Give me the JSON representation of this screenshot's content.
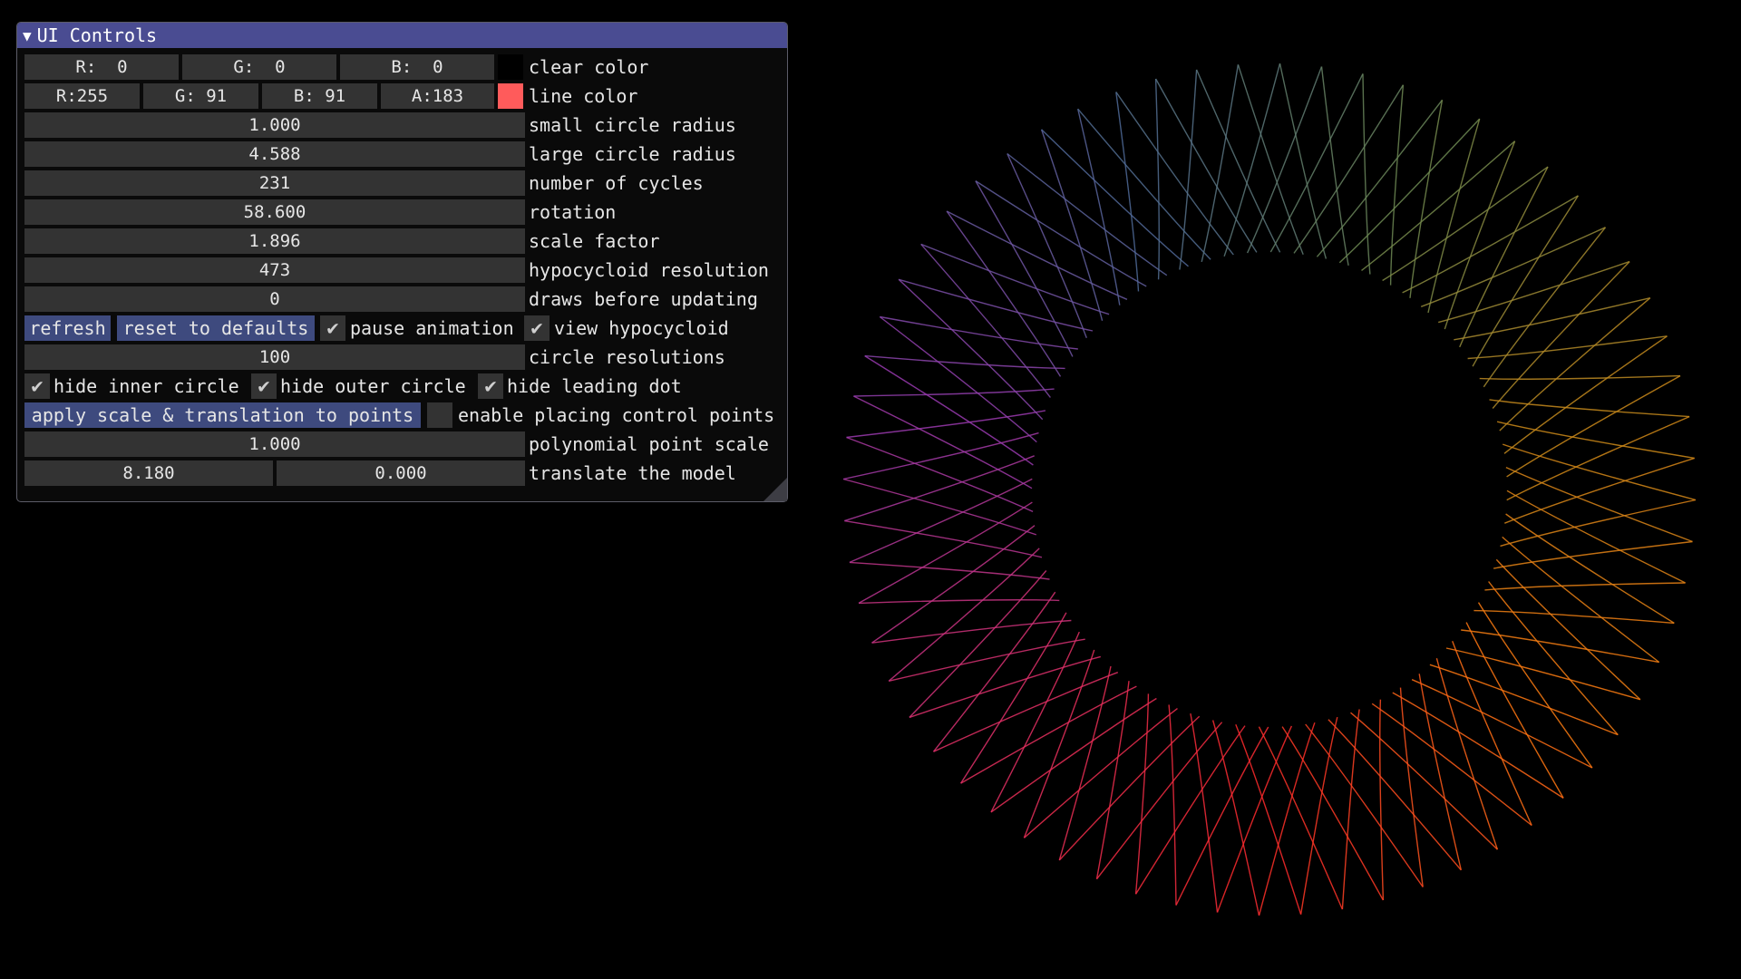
{
  "window": {
    "title": "UI Controls",
    "collapse_icon": "triangle-down-icon"
  },
  "clear_color": {
    "r": "R:  0",
    "g": "G:  0",
    "b": "B:  0",
    "swatch_color": "#000000",
    "label": "clear color"
  },
  "line_color": {
    "r": "R:255",
    "g": "G: 91",
    "b": "B: 91",
    "a": "A:183",
    "swatch_color": "#ff5b5b",
    "label": "line color"
  },
  "small_circle_radius": {
    "value": "1.000",
    "label": "small circle radius"
  },
  "large_circle_radius": {
    "value": "4.588",
    "label": "large circle radius"
  },
  "number_of_cycles": {
    "value": "231",
    "label": "number of cycles"
  },
  "rotation": {
    "value": "58.600",
    "label": "rotation"
  },
  "scale_factor": {
    "value": "1.896",
    "label": "scale factor"
  },
  "hypocycloid_resolution": {
    "value": "473",
    "label": "hypocycloid resolution"
  },
  "draws_before_updating": {
    "value": "0",
    "label": "draws before updating"
  },
  "buttons": {
    "refresh": "refresh",
    "reset": "reset to defaults",
    "apply": "apply scale & translation to points"
  },
  "pause_animation": {
    "label": "pause animation",
    "checked": true
  },
  "view_hypocycloid": {
    "label": "view hypocycloid",
    "checked": true
  },
  "circle_resolutions": {
    "value": "100",
    "label": "circle resolutions"
  },
  "hide_inner_circle": {
    "label": "hide inner circle",
    "checked": true
  },
  "hide_outer_circle": {
    "label": "hide outer circle",
    "checked": true
  },
  "hide_leading_dot": {
    "label": "hide leading dot",
    "checked": true
  },
  "enable_control_points": {
    "label": "enable placing control points",
    "checked": false
  },
  "polynomial_point_scale": {
    "value": "1.000",
    "label": "polynomial point scale"
  },
  "translate_model": {
    "x": "8.180",
    "y": "0.000",
    "label": "translate the model"
  },
  "check_glyph": "✔",
  "visualization": {
    "type": "hypocycloid-envelope",
    "cusp_count": 64,
    "gradient_colors": [
      "#ff2a2a",
      "#ff7a10",
      "#c98a1a",
      "#6e8a50",
      "#4f6a98",
      "#9a3ab0",
      "#e0306a"
    ]
  }
}
